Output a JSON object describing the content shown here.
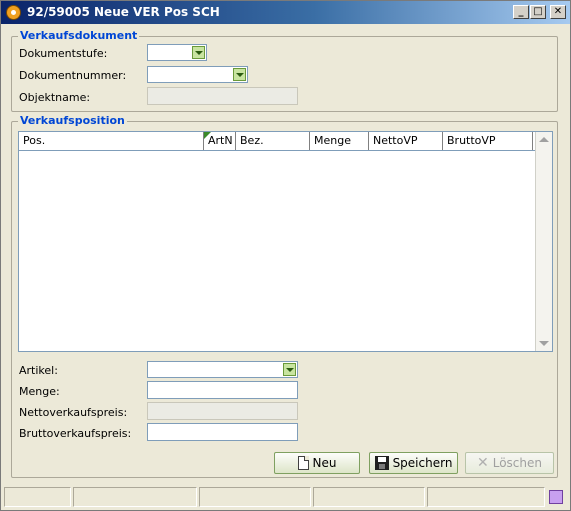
{
  "window": {
    "title": "92/59005 Neue VER Pos SCH",
    "min_glyph": "_",
    "max_glyph": "□",
    "close_glyph": "✕"
  },
  "verkaufsdokument": {
    "legend": "Verkaufsdokument",
    "dokumentstufe_label": "Dokumentstufe:",
    "dokumentstufe_value": "",
    "dokumentnummer_label": "Dokumentnummer:",
    "dokumentnummer_value": "",
    "objektname_label": "Objektname:",
    "objektname_value": ""
  },
  "verkaufsposition": {
    "legend": "Verkaufsposition",
    "columns": [
      "Pos.",
      "ArtN",
      "Bez.",
      "Menge",
      "NettoVP",
      "BruttoVP"
    ],
    "rows": [],
    "artikel_label": "Artikel:",
    "artikel_value": "",
    "menge_label": "Menge:",
    "menge_value": "",
    "nettoverkaufspreis_label": "Nettoverkaufspreis:",
    "nettoverkaufspreis_value": "",
    "bruttoverkaufspreis_label": "Bruttoverkaufspreis:",
    "bruttoverkaufspreis_value": ""
  },
  "buttons": {
    "neu": "Neu",
    "speichern": "Speichern",
    "loeschen": "Löschen"
  },
  "icons": {
    "app": "app-icon",
    "neu": "new-document-icon",
    "speichern": "floppy-disk-icon",
    "loeschen": "delete-x-icon"
  },
  "colors": {
    "legend": "#0046d5",
    "window_bg": "#ece9d8",
    "title_start": "#0a246a",
    "title_end": "#a6caf0"
  }
}
